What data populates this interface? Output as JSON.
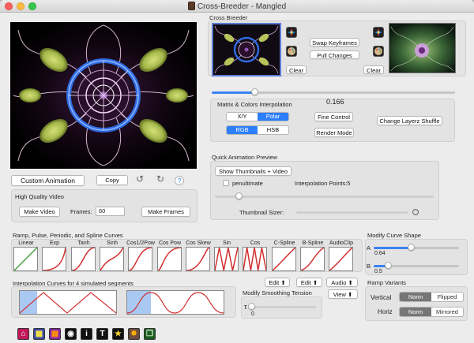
{
  "window": {
    "title": "Cross-Breeder - Mangled"
  },
  "left": {
    "custom_animation": "Custom Animation",
    "copy": "Copy",
    "help": "?",
    "hq_label": "High Quality Video",
    "make_video": "Make Video",
    "frames_label": "Frames:",
    "frames_value": "60",
    "make_frames": "Make Frames"
  },
  "cross_breeder": {
    "title": "Cross Breeder",
    "swap_keyframes": "Swap Keyframes",
    "pull_changes": "Pull Changes",
    "clear_left": "Clear",
    "clear_right": "Clear",
    "slider_fraction": 0.166
  },
  "matrix": {
    "title": "Matrix & Colors Interpolation",
    "value": "0.166",
    "xy": "X/Y",
    "polar": "Polar",
    "rgb": "RGB",
    "hsb": "HSB",
    "fine_control": "Fine Control",
    "render_mode": "Render Mode",
    "change_layerz": "Change Layerz Shuffle"
  },
  "preview": {
    "title": "Quick Animation Preview",
    "show_thumbnails": "Show Thumbnails + Video",
    "penultimate": "penultimate",
    "interp_points": "Interpolation Points:5",
    "thumbnail_sizer": "Thumbnail Sizer:"
  },
  "curves": {
    "title": "Ramp, Pulse, Periodic, and Spline Curves",
    "items": [
      {
        "label": "Linear"
      },
      {
        "label": "Exp"
      },
      {
        "label": "Tanh"
      },
      {
        "label": "Sinh"
      },
      {
        "label": "Cos1/2Pow"
      },
      {
        "label": "Cos Pow"
      },
      {
        "label": "Cos Skew"
      },
      {
        "label": "Sin"
      },
      {
        "label": "Cos"
      },
      {
        "label": "C-Spline"
      },
      {
        "label": "B-Spline"
      },
      {
        "label": "AudioClip"
      }
    ]
  },
  "modify_shape": {
    "title": "Modify Curve Shape",
    "a_label": "A",
    "a_value": "0.64",
    "b_label": "B",
    "b_value": "0.5"
  },
  "interp_curves": {
    "title": "Interpolation Curves for 4 simulated segments"
  },
  "edit_buttons": {
    "edit1": "Edit",
    "edit2": "Edit",
    "audio": "Audio",
    "view": "View"
  },
  "smoothing": {
    "title": "Modify Smoothing Tension",
    "tau": "τ",
    "value": "0"
  },
  "ramp": {
    "title": "Ramp Variants",
    "vertical_label": "Vertical",
    "vertical_norm": "Norm",
    "vertical_flipped": "Flipped",
    "horiz_label": "Horiz",
    "horiz_norm": "Norm",
    "horiz_mirrored": "Mirrored"
  },
  "toolbar": [
    {
      "icon": "home-icon",
      "color": "#c2185b"
    },
    {
      "icon": "grid-icon",
      "color": "#3949ab"
    },
    {
      "icon": "palette-grid-icon",
      "color": "#8e24aa"
    },
    {
      "icon": "eye-icon",
      "color": "#111111"
    },
    {
      "icon": "info-icon",
      "color": "#111111"
    },
    {
      "icon": "text-icon",
      "color": "#111111"
    },
    {
      "icon": "star-icon",
      "color": "#111111"
    },
    {
      "icon": "starburst-icon",
      "color": "#5d4037"
    },
    {
      "icon": "layers-icon",
      "color": "#1b5e20"
    }
  ]
}
